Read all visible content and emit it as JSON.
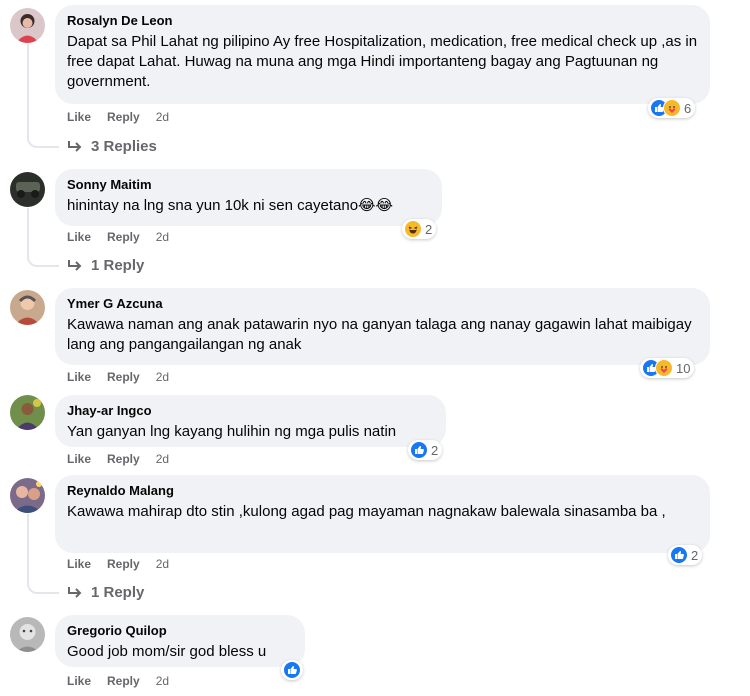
{
  "comments": [
    {
      "author": "Rosalyn De Leon",
      "text": "Dapat sa Phil Lahat ng pilipino Ay free Hospitalization, medication, free medical check up ,as in free dapat Lahat. Huwag na muna ang mga Hindi importanteng bagay ang Pagtuunan ng government.",
      "reactions": [
        "like",
        "care"
      ],
      "reaction_count": "6",
      "like_label": "Like",
      "reply_label": "Reply",
      "time": "2d",
      "replies_label": "3 Replies"
    },
    {
      "author": "Sonny Maitim",
      "text": "hinintay na lng sna yun 10k ni sen cayetano😂😂",
      "reactions": [
        "haha"
      ],
      "reaction_count": "2",
      "like_label": "Like",
      "reply_label": "Reply",
      "time": "2d",
      "replies_label": "1 Reply"
    },
    {
      "author": "Ymer G Azcuna",
      "text": "Kawawa naman ang anak patawarin nyo na ganyan talaga ang nanay gagawin lahat maibigay lang ang pangangailangan ng anak",
      "reactions": [
        "like",
        "care"
      ],
      "reaction_count": "10",
      "like_label": "Like",
      "reply_label": "Reply",
      "time": "2d"
    },
    {
      "author": "Jhay-ar Ingco",
      "text": "Yan ganyan lng kayang hulihin ng mga pulis natin",
      "reactions": [
        "like"
      ],
      "reaction_count": "2",
      "like_label": "Like",
      "reply_label": "Reply",
      "time": "2d"
    },
    {
      "author": "Reynaldo Malang",
      "text": "Kawawa mahirap dto stin ,kulong agad pag mayaman nagnakaw balewala sinasamba ba ,",
      "reactions": [
        "like"
      ],
      "reaction_count": "2",
      "like_label": "Like",
      "reply_label": "Reply",
      "time": "2d",
      "replies_label": "1 Reply"
    },
    {
      "author": "Gregorio Quilop",
      "text": "Good job mom/sir god bless u",
      "reactions": [
        "like"
      ],
      "reaction_count": "",
      "like_label": "Like",
      "reply_label": "Reply",
      "time": "2d"
    }
  ],
  "colors": {
    "bubble": "#f0f2f5",
    "meta": "#65676b",
    "like": "#1877f2",
    "emoji": "#f7b928"
  }
}
